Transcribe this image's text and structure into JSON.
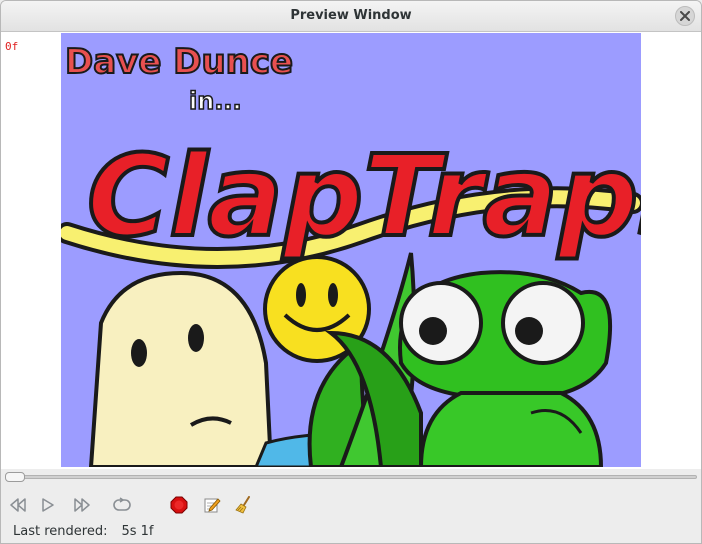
{
  "window": {
    "title": "Preview Window"
  },
  "preview": {
    "frame_label": "0f"
  },
  "status": {
    "label": "Last rendered:",
    "value": "5s 1f"
  },
  "logo_text": {
    "line1": "Dave Dunce",
    "line2": "in...",
    "line3": "ClapTraps"
  },
  "colors": {
    "background": "#9c9cff",
    "title_red": "#e82028",
    "frog_green": "#30c020",
    "smiley_yellow": "#f8e020"
  }
}
